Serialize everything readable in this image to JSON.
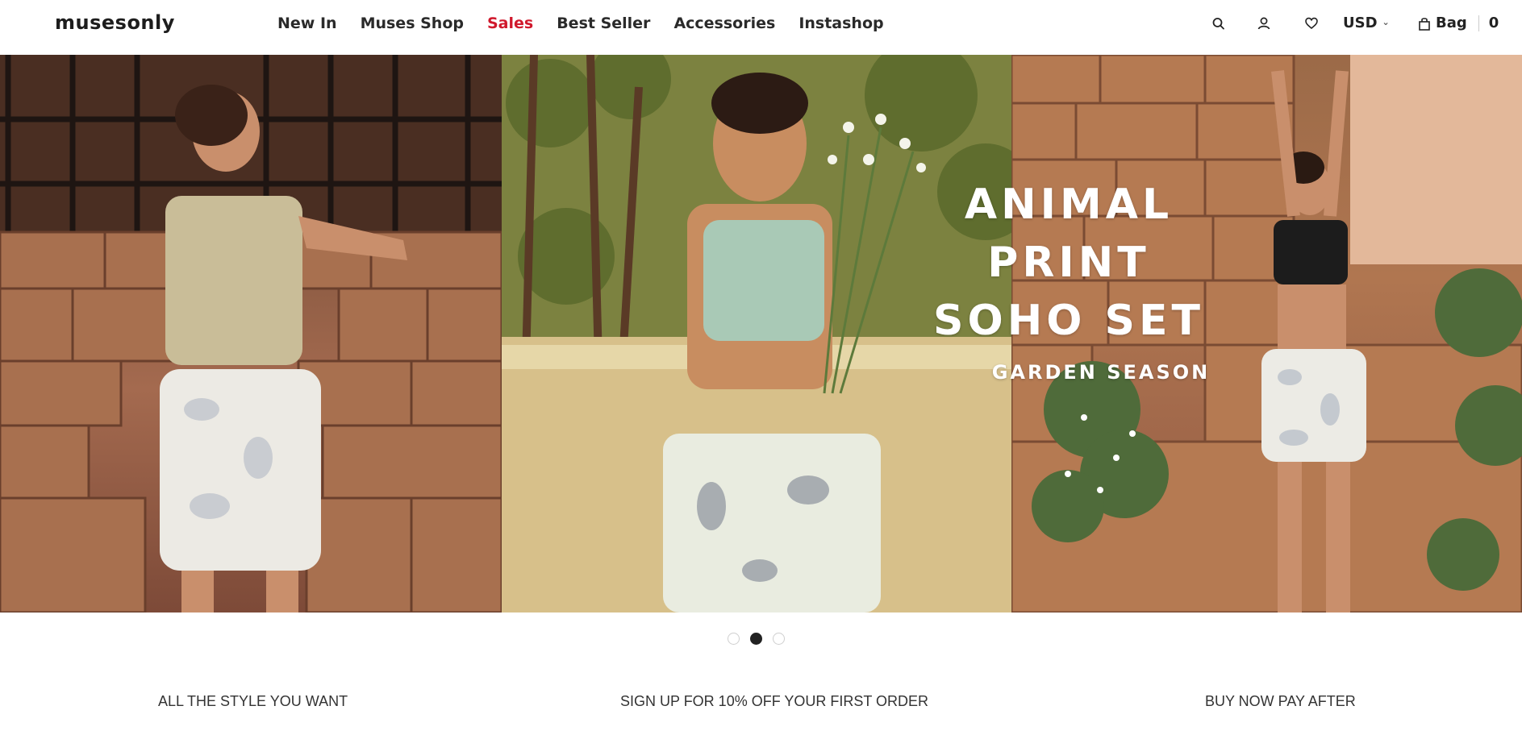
{
  "header": {
    "logo": "musesonly",
    "nav": [
      {
        "label": "New In"
      },
      {
        "label": "Muses Shop"
      },
      {
        "label": "Sales"
      },
      {
        "label": "Best Seller"
      },
      {
        "label": "Accessories"
      },
      {
        "label": "Instashop"
      }
    ],
    "icons": [
      "search-icon",
      "user-icon",
      "heart-icon"
    ],
    "currency": "USD",
    "bag_label": "Bag",
    "bag_count": "0",
    "sale_color": "#d0182c"
  },
  "hero": {
    "title_line1": "ANIMAL PRINT",
    "title_line2": "SOHO SET",
    "subtitle": "GARDEN SEASON",
    "slides": 3,
    "active_slide": 2
  },
  "promo": {
    "left": "ALL THE STYLE YOU WANT",
    "center": "SIGN UP FOR 10% OFF YOUR FIRST ORDER",
    "right": "BUY NOW PAY AFTER"
  }
}
